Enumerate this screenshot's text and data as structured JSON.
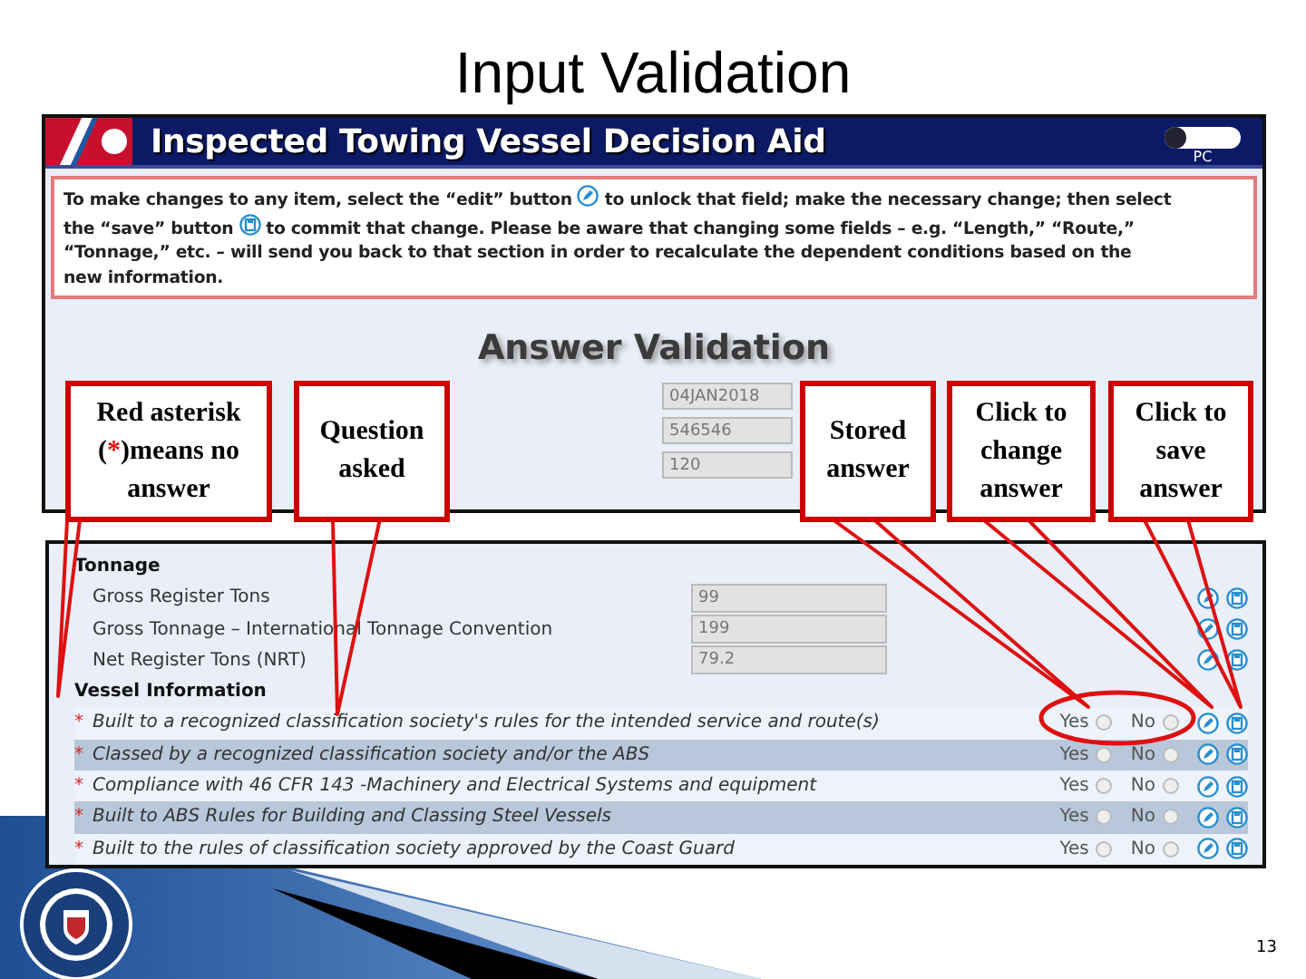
{
  "slide_title": "Input Validation",
  "app": {
    "title": "Inspected Towing Vessel Decision Aid",
    "toggle_on": false,
    "toggle_label": "PC",
    "notice_lines": [
      [
        {
          "kind": "text",
          "text": "To make changes to any item, select the “edit” button"
        },
        {
          "kind": "edit_button"
        },
        {
          "kind": "text",
          "text": "to unlock that field; make the necessary change; then select"
        }
      ],
      [
        {
          "kind": "text",
          "text": "the “save” button"
        },
        {
          "kind": "save_button"
        },
        {
          "kind": "text",
          "text": "to commit that change.  Please be aware that changing some fields – e.g. “Length,” “Route,”"
        }
      ],
      [
        {
          "kind": "text",
          "text": "“Tonnage,” etc. – will send you back to that section in order to recalculate the dependent conditions based on the"
        }
      ],
      [
        {
          "kind": "text",
          "text": "new information."
        }
      ]
    ],
    "section_title": "Answer Validation",
    "stored_fields": [
      "04JAN2018",
      "546546",
      "120"
    ]
  },
  "answers": {
    "sections": [
      {
        "title": "Tonnage",
        "rows": [
          {
            "kind": "field",
            "label": "Gross Register Tons",
            "value": "99"
          },
          {
            "kind": "field",
            "label": "Gross Tonnage – International Tonnage Convention",
            "value": "199"
          },
          {
            "kind": "field",
            "label": "Net Register Tons (NRT)",
            "value": "79.2"
          }
        ]
      },
      {
        "title": "Vessel Information",
        "rows": [
          {
            "kind": "question",
            "asterisk": "*",
            "label": "Built to a recognized classification society's rules for the intended service and route(s)",
            "yes": "Yes",
            "no": "No",
            "shaded": false
          },
          {
            "kind": "question",
            "asterisk": "*",
            "label": "Classed by a recognized classification society and/or the ABS",
            "yes": "Yes",
            "no": "No",
            "shaded": true
          },
          {
            "kind": "question",
            "asterisk": "*",
            "label": "Compliance with 46 CFR 143 -Machinery and Electrical Systems and equipment",
            "yes": "Yes",
            "no": "No",
            "shaded": false
          },
          {
            "kind": "question",
            "asterisk": "*",
            "label": "Built to ABS Rules for Building and Classing Steel Vessels",
            "yes": "Yes",
            "no": "No",
            "shaded": true
          },
          {
            "kind": "question",
            "asterisk": "*",
            "label": "Built to the rules of classification society approved by the Coast Guard",
            "yes": "Yes",
            "no": "No",
            "shaded": false
          }
        ]
      }
    ]
  },
  "callouts": [
    {
      "lines": [
        [
          {
            "kind": "plain",
            "text": "Red asterisk"
          }
        ],
        [
          {
            "kind": "plain",
            "text": "("
          },
          {
            "kind": "asterisk",
            "text": "*"
          },
          {
            "kind": "plain",
            "text": ")means no"
          }
        ],
        [
          {
            "kind": "plain",
            "text": "answer"
          }
        ]
      ]
    },
    {
      "lines": [
        [
          {
            "kind": "plain",
            "text": "Question"
          }
        ],
        [
          {
            "kind": "plain",
            "text": "asked"
          }
        ]
      ]
    },
    {
      "lines": [
        [
          {
            "kind": "plain",
            "text": "Stored"
          }
        ],
        [
          {
            "kind": "plain",
            "text": "answer"
          }
        ]
      ]
    },
    {
      "lines": [
        [
          {
            "kind": "plain",
            "text": "Click to"
          }
        ],
        [
          {
            "kind": "plain",
            "text": "change"
          }
        ],
        [
          {
            "kind": "plain",
            "text": "answer"
          }
        ]
      ]
    },
    {
      "lines": [
        [
          {
            "kind": "plain",
            "text": "Click to"
          }
        ],
        [
          {
            "kind": "plain",
            "text": "save"
          }
        ],
        [
          {
            "kind": "plain",
            "text": "answer"
          }
        ]
      ]
    }
  ],
  "page_number": "13"
}
